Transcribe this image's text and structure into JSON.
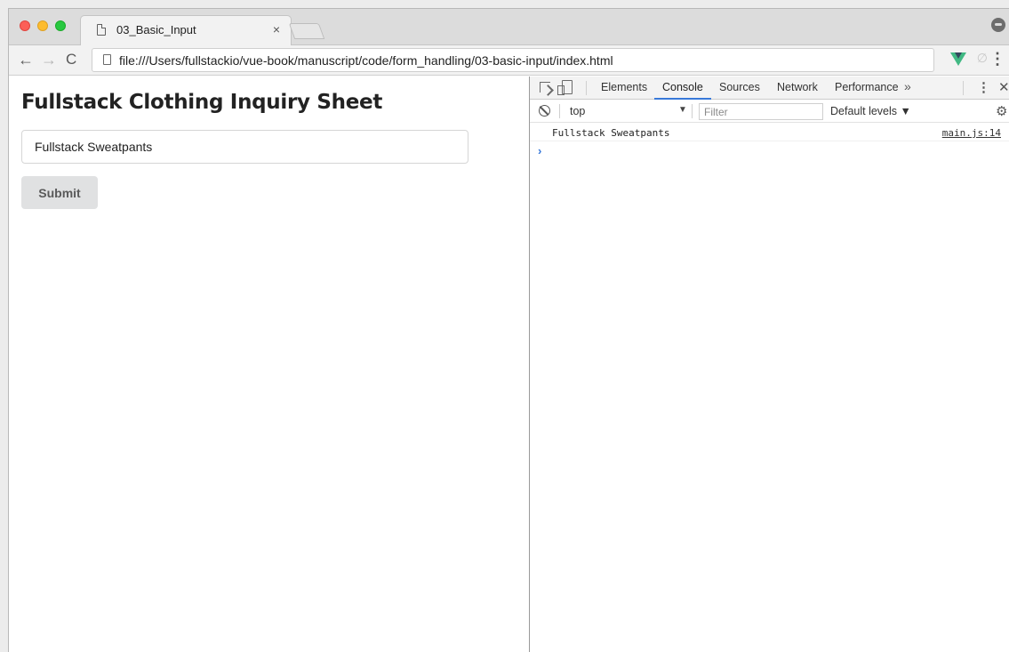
{
  "browser": {
    "tab_title": "03_Basic_Input",
    "tab_close": "×",
    "url": "file:///Users/fullstackio/vue-book/manuscript/code/form_handling/03-basic-input/index.html",
    "nav": {
      "back": "←",
      "forward": "→",
      "reload": "C"
    },
    "menu": "⋮",
    "extension_link": "∅"
  },
  "page": {
    "title": "Fullstack Clothing Inquiry Sheet",
    "input_value": "Fullstack Sweatpants",
    "submit_label": "Submit"
  },
  "devtools": {
    "tabs": [
      "Elements",
      "Console",
      "Sources",
      "Network",
      "Performance"
    ],
    "active_tab": "Console",
    "more": "»",
    "kebab": "⋮",
    "close": "✕",
    "context": "top",
    "context_arrow": "▼",
    "filter_placeholder": "Filter",
    "levels": "Default levels ▼",
    "gear": "⚙",
    "console": {
      "message": "Fullstack Sweatpants",
      "source": "main.js:14",
      "prompt": "›"
    }
  }
}
